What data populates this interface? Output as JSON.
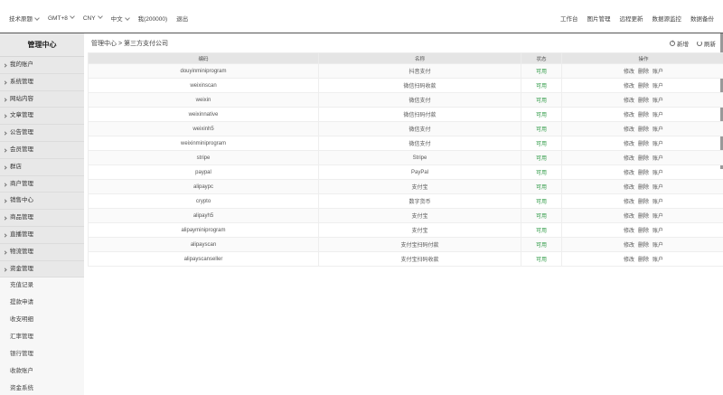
{
  "topbar": {
    "left": [
      "技术原题",
      "GMT+8",
      "CNY",
      "中文",
      "我(200000)",
      "退出"
    ],
    "right": [
      "工作台",
      "图片管理",
      "远程更新",
      "数据源监控",
      "数据备份"
    ]
  },
  "sidebar": {
    "title": "管理中心",
    "items": [
      "我的账户",
      "系统管理",
      "网站内容",
      "文章管理",
      "公告管理",
      "会员管理",
      "群店",
      "商户管理",
      "销售中心",
      "商品管理",
      "直播管理",
      "物流管理",
      "资金管理"
    ],
    "sub": [
      "充值记录",
      "提款申请",
      "收支明细",
      "汇率管理",
      "银行管理",
      "收款账户",
      "资金系统"
    ]
  },
  "breadcrumb": "管理中心 > 第三方支付公司",
  "actions": {
    "add": "新增",
    "refresh": "刷新"
  },
  "table": {
    "headers": [
      "编码",
      "名称",
      "状态",
      "操作"
    ],
    "rows": [
      {
        "code": "douyinminiprogram",
        "name": "抖音支付",
        "status": "可用"
      },
      {
        "code": "weixinscan",
        "name": "微信扫码收款",
        "status": "可用"
      },
      {
        "code": "weixin",
        "name": "微信支付",
        "status": "可用"
      },
      {
        "code": "weixinnative",
        "name": "微信扫码付款",
        "status": "可用"
      },
      {
        "code": "weixinh5",
        "name": "微信支付",
        "status": "可用"
      },
      {
        "code": "weixinminiprogram",
        "name": "微信支付",
        "status": "可用"
      },
      {
        "code": "stripe",
        "name": "Stripe",
        "status": "可用"
      },
      {
        "code": "paypal",
        "name": "PayPal",
        "status": "可用"
      },
      {
        "code": "alipaypc",
        "name": "支付宝",
        "status": "可用"
      },
      {
        "code": "crypto",
        "name": "数字货币",
        "status": "可用"
      },
      {
        "code": "alipayh5",
        "name": "支付宝",
        "status": "可用"
      },
      {
        "code": "alipayminiprogram",
        "name": "支付宝",
        "status": "可用"
      },
      {
        "code": "alipayscan",
        "name": "支付宝扫码付款",
        "status": "可用"
      },
      {
        "code": "alipayscanseller",
        "name": "支付宝扫码收款",
        "status": "可用"
      }
    ],
    "ops": [
      "修改",
      "删除",
      "账户"
    ]
  }
}
